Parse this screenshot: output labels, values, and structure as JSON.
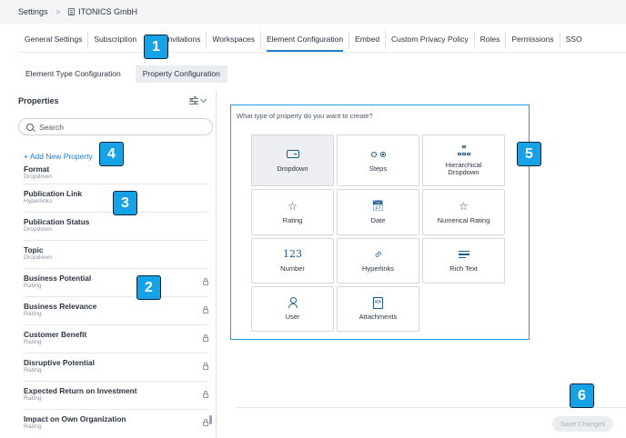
{
  "breadcrumb": {
    "root": "Settings",
    "org": "ITONICS GmbH"
  },
  "tabs": [
    {
      "label": "General Settings"
    },
    {
      "label": "Subscription"
    },
    {
      "label": "Invitations"
    },
    {
      "label": "Workspaces"
    },
    {
      "label": "Element Configuration"
    },
    {
      "label": "Embed"
    },
    {
      "label": "Custom Privacy Policy"
    },
    {
      "label": "Roles"
    },
    {
      "label": "Permissions"
    },
    {
      "label": "SSO"
    }
  ],
  "active_tab": "Element Configuration",
  "subtabs": [
    {
      "label": "Element Type Configuration"
    },
    {
      "label": "Property Configuration"
    }
  ],
  "properties": {
    "header": "Properties",
    "search_placeholder": "Search",
    "add_new_label": "+ Add New Property",
    "items": [
      {
        "name": "Format",
        "type": "Dropdown",
        "locked": false
      },
      {
        "name": "Publication Link",
        "type": "Hyperlinks",
        "locked": false
      },
      {
        "name": "Publication Status",
        "type": "Dropdown",
        "locked": false
      },
      {
        "name": "Topic",
        "type": "Dropdown",
        "locked": false
      },
      {
        "name": "Business Potential",
        "type": "Rating",
        "locked": true
      },
      {
        "name": "Business Relevance",
        "type": "Rating",
        "locked": true
      },
      {
        "name": "Customer Benefit",
        "type": "Rating",
        "locked": true
      },
      {
        "name": "Disruptive Potential",
        "type": "Rating",
        "locked": true
      },
      {
        "name": "Expected Return on Investment",
        "type": "Rating",
        "locked": true
      },
      {
        "name": "Impact on Own Organization",
        "type": "Rating",
        "locked": true
      }
    ]
  },
  "creator": {
    "question": "What type of property do you want to create?",
    "types": [
      {
        "label": "Dropdown",
        "icon": "dropdown-icon"
      },
      {
        "label": "Steps",
        "icon": "steps-icon"
      },
      {
        "label": "Hierarchical Dropdown",
        "icon": "hierarchy-icon"
      },
      {
        "label": "Rating",
        "icon": "star-icon"
      },
      {
        "label": "Date",
        "icon": "calendar-icon"
      },
      {
        "label": "Numerical Rating",
        "icon": "star-icon"
      },
      {
        "label": "Number",
        "icon": "number-icon",
        "glyph": "123"
      },
      {
        "label": "Hyperlinks",
        "icon": "link-icon"
      },
      {
        "label": "Rich Text",
        "icon": "rich-text-icon"
      },
      {
        "label": "User",
        "icon": "user-icon"
      },
      {
        "label": "Attachments",
        "icon": "attachment-icon"
      }
    ]
  },
  "save_label": "Save Changes",
  "badges": [
    "1",
    "2",
    "3",
    "4",
    "5",
    "6"
  ],
  "colors": {
    "accent": "#1f7ecb",
    "badge": "#16a2e6",
    "panel_border": "#1f9be6"
  }
}
